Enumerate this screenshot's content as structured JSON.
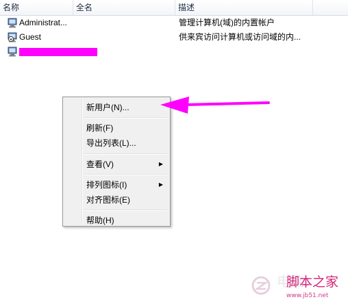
{
  "columns": {
    "name": "名称",
    "fullname": "全名",
    "description": "描述"
  },
  "rows": [
    {
      "name": "Administrat...",
      "fullname": "",
      "description": "管理计算机(域)的内置帐户"
    },
    {
      "name": "Guest",
      "fullname": "",
      "description": "供来宾访问计算机或访问域的内..."
    },
    {
      "name": "",
      "fullname": "",
      "description": "",
      "redacted": true
    }
  ],
  "context_menu": {
    "items": [
      {
        "label": "新用户(N)..."
      },
      {
        "label": "刷新(F)"
      },
      {
        "label": "导出列表(L)..."
      },
      {
        "label": "查看(V)",
        "submenu": true
      },
      {
        "label": "排列图标(I)",
        "submenu": true
      },
      {
        "label": "对齐图标(E)"
      },
      {
        "label": "帮助(H)"
      }
    ]
  },
  "annotation": {
    "arrow_color": "#ff00ff"
  },
  "watermark": {
    "faint_text": "电脑",
    "site_name": "脚本之家",
    "site_url": "www.jb51.net",
    "color": "#d4237a"
  }
}
